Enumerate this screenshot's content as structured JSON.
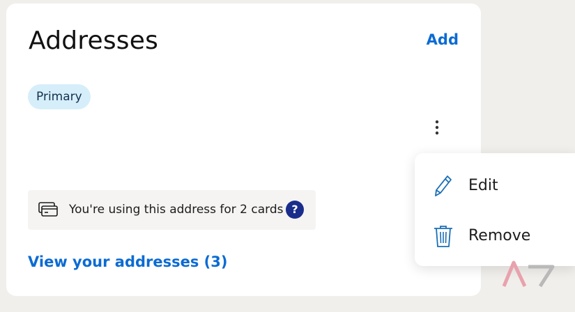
{
  "card": {
    "title": "Addresses",
    "add_label": "Add",
    "badge_label": "Primary",
    "usage_text": "You're using this address for 2 cards",
    "help_glyph": "?",
    "view_link": "View your addresses (3)"
  },
  "menu": {
    "items": [
      {
        "label": "Edit",
        "icon": "pencil-icon"
      },
      {
        "label": "Remove",
        "icon": "trash-icon"
      }
    ]
  },
  "colors": {
    "link": "#0b6bd3",
    "badge_bg": "#d6eefa",
    "help_bg": "#1a2d8a",
    "menu_icon": "#1a6fb5",
    "page_bg": "#f1efeb"
  }
}
